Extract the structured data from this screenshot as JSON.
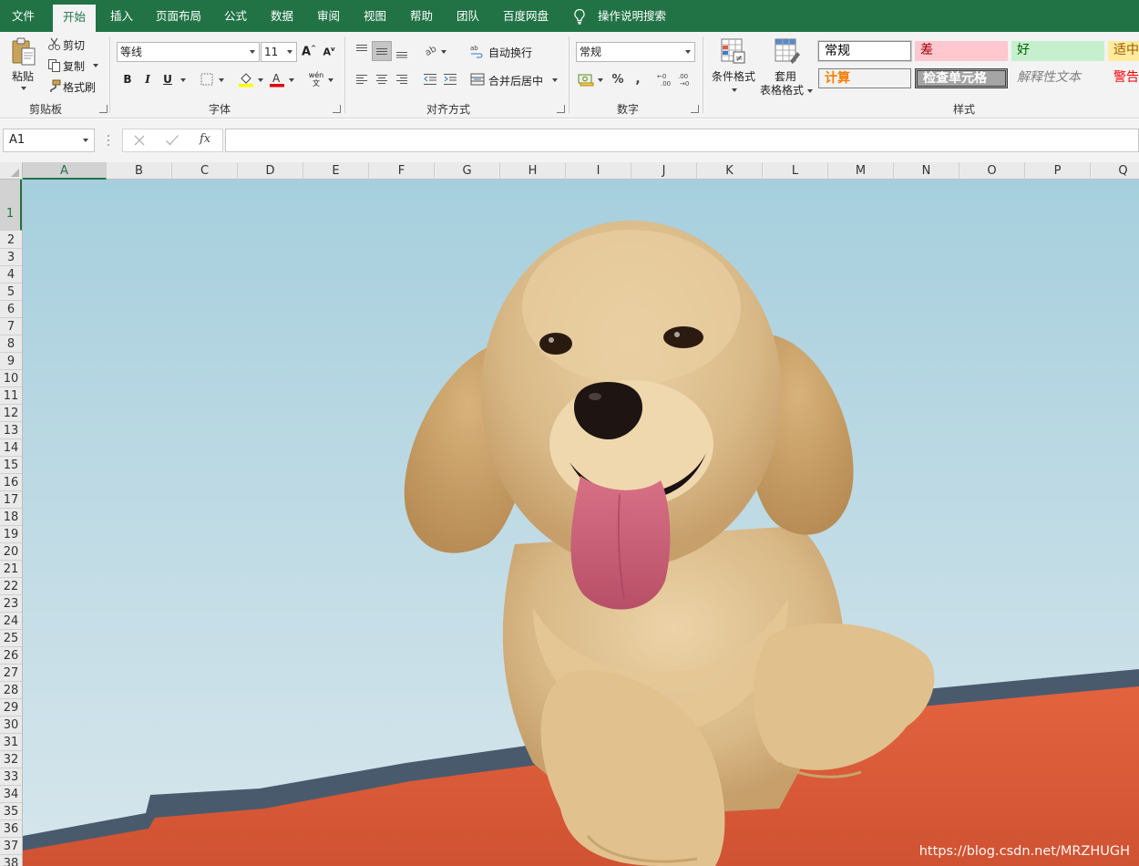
{
  "menu": {
    "tabs": [
      "文件",
      "开始",
      "插入",
      "页面布局",
      "公式",
      "数据",
      "审阅",
      "视图",
      "帮助",
      "团队",
      "百度网盘"
    ],
    "active_tab": "开始",
    "tell_me": "操作说明搜索",
    "accent": "#217346"
  },
  "ribbon": {
    "clipboard": {
      "label": "剪贴板",
      "paste": "粘贴",
      "cut": "剪切",
      "copy": "复制",
      "format_painter": "格式刷"
    },
    "font": {
      "label": "字体",
      "font_name": "等线",
      "font_size": "11",
      "bold": "B",
      "italic": "I",
      "underline": "U",
      "font_color": "A",
      "phonetic": "wén"
    },
    "alignment": {
      "label": "对齐方式",
      "wrap_text": "自动换行",
      "merge_center": "合并后居中"
    },
    "number": {
      "label": "数字",
      "format": "常规",
      "percent": "%",
      "comma": ","
    },
    "styles": {
      "label": "样式",
      "conditional_format": "条件格式",
      "format_as_table_1": "套用",
      "format_as_table_2": "表格格式",
      "cells": [
        {
          "text": "常规",
          "color": "#000000",
          "bg": "#ffffff"
        },
        {
          "text": "差",
          "color": "#9c0006",
          "bg": "#ffc7ce"
        },
        {
          "text": "好",
          "color": "#006100",
          "bg": "#c6efce"
        },
        {
          "text": "适中",
          "color": "#9c5700",
          "bg": "#ffeb9c"
        },
        {
          "text": "计算",
          "color": "#fa7d00",
          "bg": "#f2f2f2"
        },
        {
          "text": "检查单元格",
          "color": "#ffffff",
          "bg": "#a5a5a5"
        },
        {
          "text": "解释性文本",
          "color": "#7f7f7f",
          "bg": "#f3f3f3"
        },
        {
          "text": "警告",
          "color": "#ff0000",
          "bg": "#f3f3f3"
        }
      ]
    }
  },
  "formula_bar": {
    "name_box": "A1",
    "fx": "fx",
    "formula": ""
  },
  "grid": {
    "columns": [
      "A",
      "B",
      "C",
      "D",
      "E",
      "F",
      "G",
      "H",
      "I",
      "J",
      "K",
      "L",
      "M",
      "N",
      "O",
      "P",
      "Q"
    ],
    "rows": [
      "1",
      "2",
      "3",
      "4",
      "5",
      "6",
      "7",
      "8",
      "9",
      "10",
      "11",
      "12",
      "13",
      "14",
      "15",
      "16",
      "17",
      "18",
      "19",
      "20",
      "21",
      "22",
      "23",
      "24",
      "25",
      "26",
      "27",
      "28",
      "29",
      "30",
      "31",
      "32",
      "33",
      "34",
      "35",
      "36",
      "37",
      "38"
    ],
    "selected_cell": "A1"
  },
  "image": {
    "subject": "golden retriever puppy with tongue out leaning over an orange wall against a pale blue sky",
    "sky_color": "#a9cfdc",
    "wall_color": "#dd5b38",
    "fur_color": "#d9b98a",
    "tongue_color": "#c7607a"
  },
  "watermark": "https://blog.csdn.net/MRZHUGH"
}
